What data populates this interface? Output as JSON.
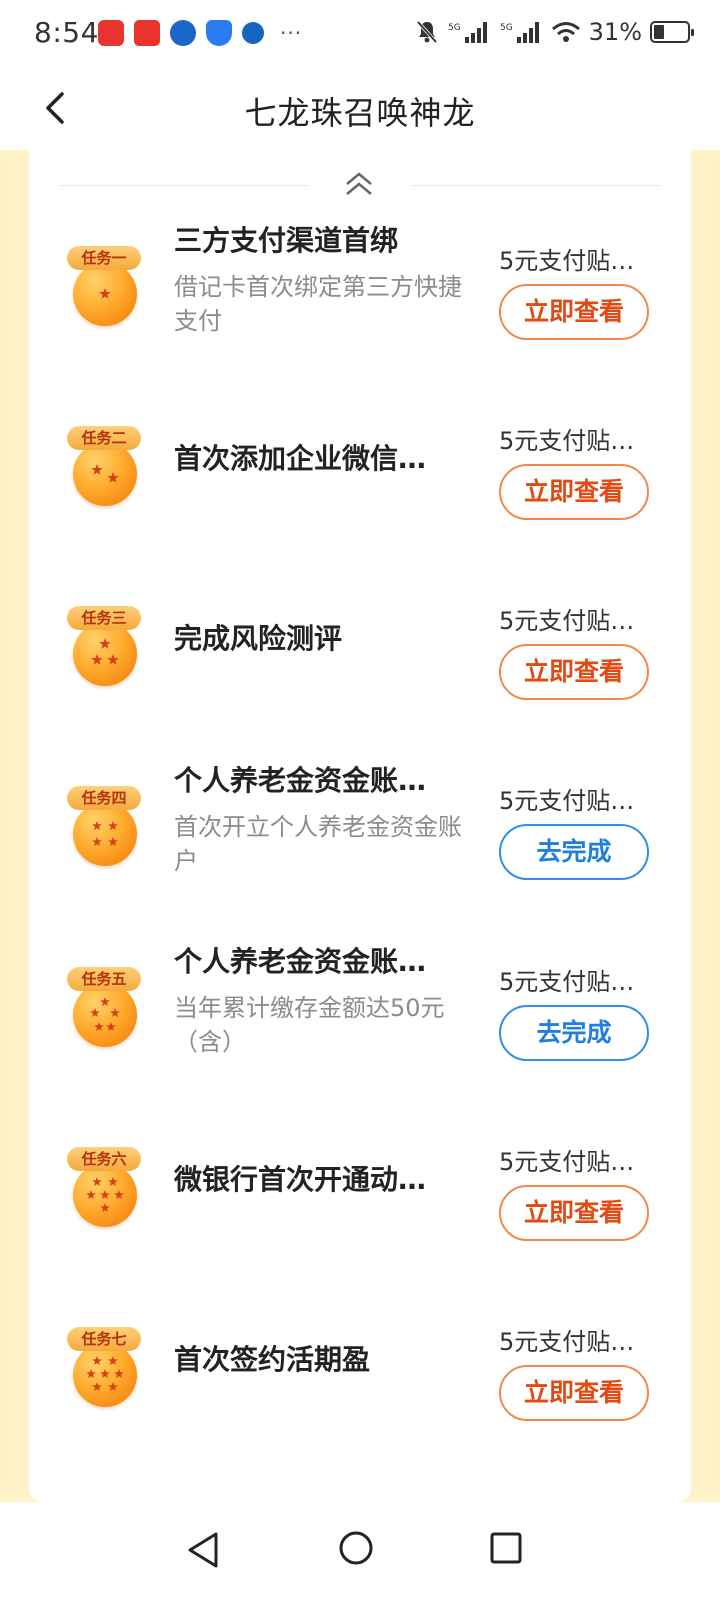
{
  "status": {
    "time": "8:54",
    "battery": "31%",
    "net1": "5G",
    "net2": "5G",
    "icons": [
      "app-icon-red",
      "app-icon-yunshanfu",
      "app-icon-ccb",
      "app-icon-shield",
      "app-icon-blue"
    ]
  },
  "header": {
    "title": "七龙珠召唤神龙"
  },
  "tasks": [
    {
      "tag": "任务一",
      "stars": 1,
      "title": "三方支付渠道首绑",
      "desc": "借记卡首次绑定第三方快捷支付",
      "reward": "5元支付贴…",
      "action": "立即查看",
      "style": "orange"
    },
    {
      "tag": "任务二",
      "stars": 2,
      "title": "首次添加企业微信…",
      "desc": "",
      "reward": "5元支付贴…",
      "action": "立即查看",
      "style": "orange"
    },
    {
      "tag": "任务三",
      "stars": 3,
      "title": "完成风险测评",
      "desc": "",
      "reward": "5元支付贴…",
      "action": "立即查看",
      "style": "orange"
    },
    {
      "tag": "任务四",
      "stars": 4,
      "title": "个人养老金资金账…",
      "desc": "首次开立个人养老金资金账户",
      "reward": "5元支付贴…",
      "action": "去完成",
      "style": "blue"
    },
    {
      "tag": "任务五",
      "stars": 5,
      "title": "个人养老金资金账…",
      "desc": "当年累计缴存金额达50元（含）",
      "reward": "5元支付贴…",
      "action": "去完成",
      "style": "blue"
    },
    {
      "tag": "任务六",
      "stars": 6,
      "title": "微银行首次开通动…",
      "desc": "",
      "reward": "5元支付贴…",
      "action": "立即查看",
      "style": "orange"
    },
    {
      "tag": "任务七",
      "stars": 7,
      "title": "首次签约活期盈",
      "desc": "",
      "reward": "5元支付贴…",
      "action": "立即查看",
      "style": "orange"
    }
  ],
  "colors": {
    "accent_orange": "#e24a13",
    "accent_blue": "#1f7fdc",
    "backdrop": "#fff2c6"
  }
}
